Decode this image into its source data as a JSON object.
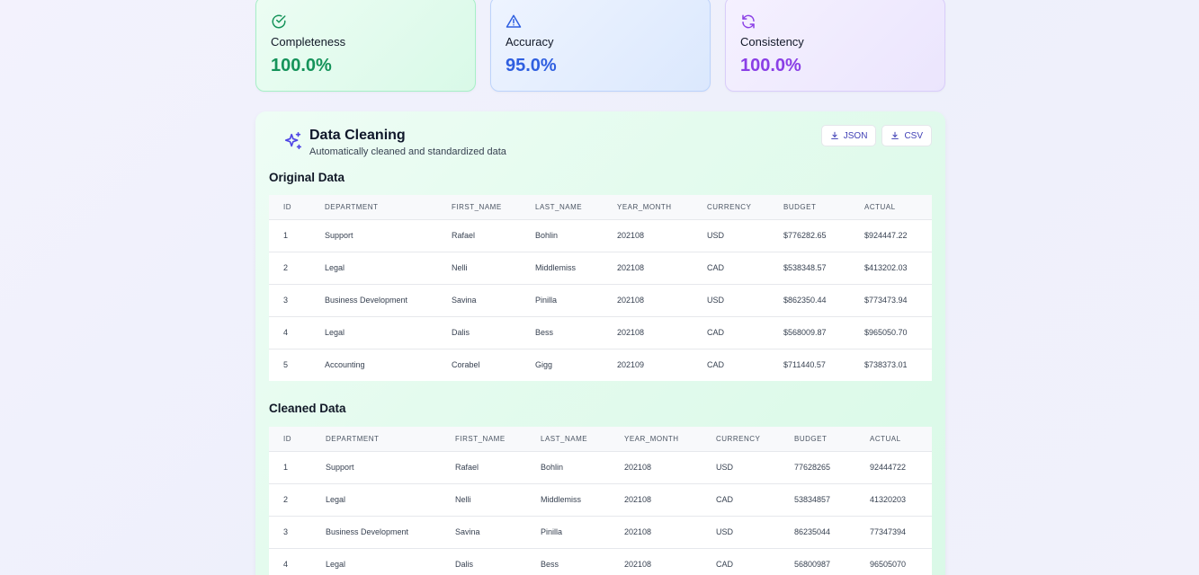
{
  "metrics": [
    {
      "label": "Completeness",
      "value": "100.0%",
      "icon": "check-circle-icon",
      "color": "#15935a"
    },
    {
      "label": "Accuracy",
      "value": "95.0%",
      "icon": "warning-triangle-icon",
      "color": "#2f5fe0"
    },
    {
      "label": "Consistency",
      "value": "100.0%",
      "icon": "refresh-icon",
      "color": "#8a3fe6"
    }
  ],
  "panel": {
    "title": "Data Cleaning",
    "subtitle": "Automatically cleaned and standardized data",
    "icon": "sparkles-icon",
    "export_json": "JSON",
    "export_csv": "CSV"
  },
  "original": {
    "title": "Original Data",
    "columns": [
      "ID",
      "DEPARTMENT",
      "FIRST_NAME",
      "LAST_NAME",
      "YEAR_MONTH",
      "CURRENCY",
      "BUDGET",
      "ACTUAL"
    ],
    "rows": [
      [
        "1",
        "Support",
        "Rafael",
        "Bohlin",
        "202108",
        "USD",
        "$776282.65",
        "$924447.22"
      ],
      [
        "2",
        "Legal",
        "Nelli",
        "Middlemiss",
        "202108",
        "CAD",
        "$538348.57",
        "$413202.03"
      ],
      [
        "3",
        "Business Development",
        "Savina",
        "Pinilla",
        "202108",
        "USD",
        "$862350.44",
        "$773473.94"
      ],
      [
        "4",
        "Legal",
        "Dalis",
        "Bess",
        "202108",
        "CAD",
        "$568009.87",
        "$965050.70"
      ],
      [
        "5",
        "Accounting",
        "Corabel",
        "Gigg",
        "202109",
        "CAD",
        "$711440.57",
        "$738373.01"
      ]
    ]
  },
  "cleaned": {
    "title": "Cleaned Data",
    "columns": [
      "ID",
      "DEPARTMENT",
      "FIRST_NAME",
      "LAST_NAME",
      "YEAR_MONTH",
      "CURRENCY",
      "BUDGET",
      "ACTUAL"
    ],
    "rows": [
      [
        "1",
        "Support",
        "Rafael",
        "Bohlin",
        "202108",
        "USD",
        "77628265",
        "92444722"
      ],
      [
        "2",
        "Legal",
        "Nelli",
        "Middlemiss",
        "202108",
        "CAD",
        "53834857",
        "41320203"
      ],
      [
        "3",
        "Business Development",
        "Savina",
        "Pinilla",
        "202108",
        "USD",
        "86235044",
        "77347394"
      ],
      [
        "4",
        "Legal",
        "Dalis",
        "Bess",
        "202108",
        "CAD",
        "56800987",
        "96505070"
      ]
    ]
  }
}
